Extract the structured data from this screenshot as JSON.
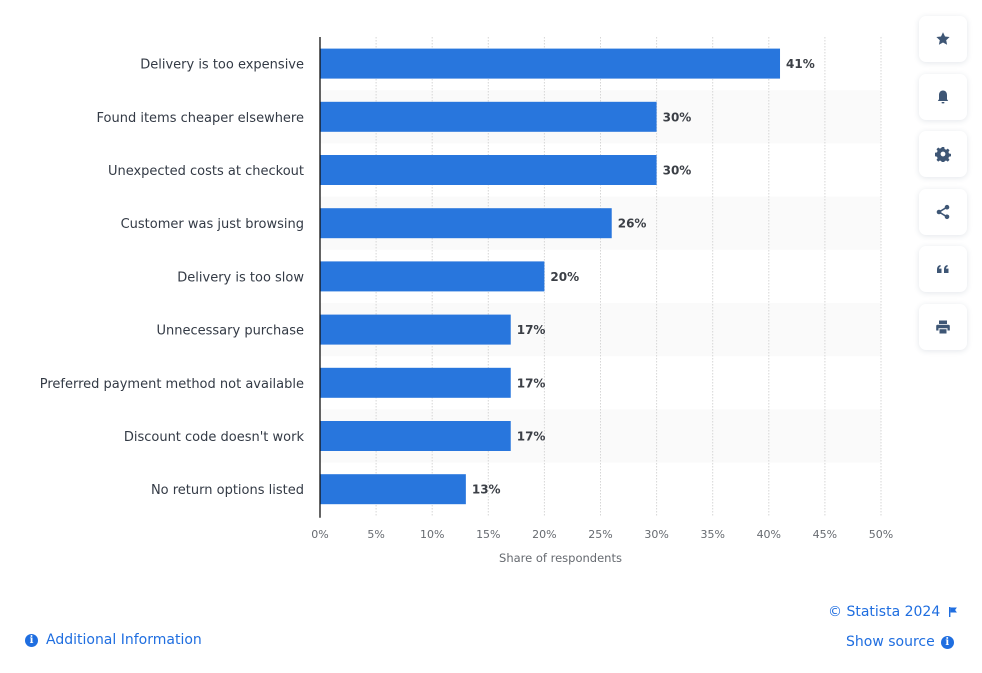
{
  "chart_data": {
    "type": "bar",
    "orientation": "horizontal",
    "categories": [
      "Delivery is too expensive",
      "Found items cheaper elsewhere",
      "Unexpected costs at checkout",
      "Customer was just browsing",
      "Delivery is too slow",
      "Unnecessary purchase",
      "Preferred payment method not available",
      "Discount code doesn't work",
      "No return options listed"
    ],
    "values": [
      41,
      30,
      30,
      26,
      20,
      17,
      17,
      17,
      13
    ],
    "value_labels": [
      "41%",
      "30%",
      "30%",
      "26%",
      "20%",
      "17%",
      "17%",
      "17%",
      "13%"
    ],
    "title": "",
    "xlabel": "Share of respondents",
    "ylabel": "",
    "xlim": [
      0,
      50
    ],
    "xticks": [
      0,
      5,
      10,
      15,
      20,
      25,
      30,
      35,
      40,
      45,
      50
    ],
    "xtick_labels": [
      "0%",
      "5%",
      "10%",
      "15%",
      "20%",
      "25%",
      "30%",
      "35%",
      "40%",
      "45%",
      "50%"
    ],
    "grid": "vertical dotted",
    "legend": "none",
    "bar_color": "#2876dd"
  },
  "sidebar": {
    "buttons": [
      {
        "name": "favorite",
        "icon": "star-icon"
      },
      {
        "name": "notification",
        "icon": "bell-icon"
      },
      {
        "name": "settings",
        "icon": "gear-icon"
      },
      {
        "name": "share",
        "icon": "share-icon"
      },
      {
        "name": "cite",
        "icon": "quote-icon"
      },
      {
        "name": "print",
        "icon": "print-icon"
      }
    ]
  },
  "footer": {
    "copyright": "© Statista 2024",
    "show_source": "Show source",
    "additional_info": "Additional Information",
    "info_glyph": "i"
  },
  "colors": {
    "accent": "#1f6ee0",
    "bar": "#2876dd",
    "icon": "#3e5675"
  }
}
